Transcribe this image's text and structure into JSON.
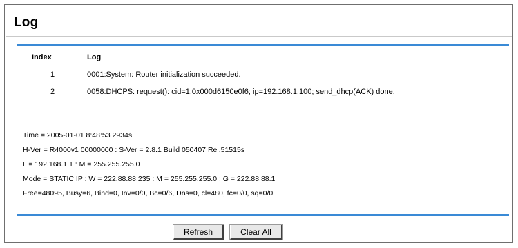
{
  "page": {
    "title": "Log"
  },
  "log_table": {
    "headers": {
      "index": "Index",
      "log": "Log"
    },
    "rows": [
      {
        "index": "1",
        "log": "0001:System: Router initialization succeeded."
      },
      {
        "index": "2",
        "log": "0058:DHCPS: request(): cid=1:0x000d6150e0f6; ip=192.168.1.100; send_dhcp(ACK) done."
      }
    ]
  },
  "status": {
    "time": "Time = 2005-01-01 8:48:53 2934s",
    "version": "H-Ver = R4000v1 00000000 : S-Ver = 2.8.1 Build 050407 Rel.51515s",
    "lan": "L = 192.168.1.1 : M = 255.255.255.0",
    "wan": "Mode = STATIC IP : W = 222.88.88.235 : M = 255.255.255.0 : G = 222.88.88.1",
    "stats": "Free=48095, Busy=6, Bind=0, Inv=0/0, Bc=0/6, Dns=0, cl=480, fc=0/0, sq=0/0"
  },
  "buttons": {
    "refresh": "Refresh",
    "clear_all": "Clear All"
  },
  "colors": {
    "accent_rule": "#3a8ad6",
    "frame_border": "#6f6f6f"
  }
}
